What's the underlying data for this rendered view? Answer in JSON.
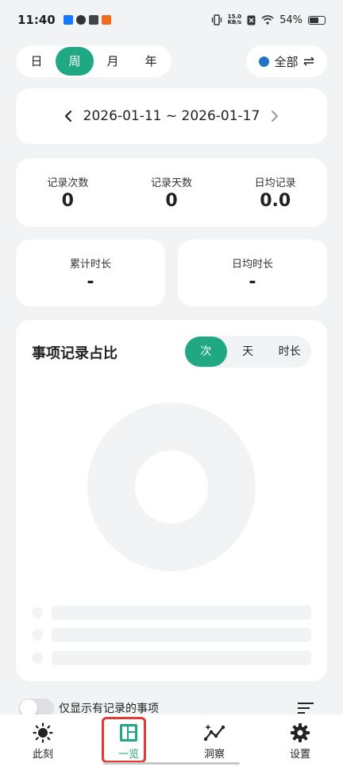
{
  "status": {
    "time": "11:40",
    "net_speed_top": "15.0",
    "net_speed_bottom": "KB/s",
    "battery": "54%"
  },
  "period": {
    "options": [
      "日",
      "周",
      "月",
      "年"
    ],
    "selected": "周"
  },
  "filter": {
    "label": "全部",
    "dot_color": "#1f74c4"
  },
  "date_range": {
    "text": "2026-01-11 ~ 2026-01-17"
  },
  "stats": {
    "record_count": {
      "label": "记录次数",
      "value": "0"
    },
    "record_days": {
      "label": "记录天数",
      "value": "0"
    },
    "daily_avg_records": {
      "label": "日均记录",
      "value": "0.0"
    },
    "total_duration": {
      "label": "累计时长",
      "value": "-"
    },
    "daily_avg_duration": {
      "label": "日均时长",
      "value": "-"
    }
  },
  "chart": {
    "title": "事项记录占比",
    "metric_options": [
      "次",
      "天",
      "时长"
    ],
    "selected_metric": "次"
  },
  "toggle": {
    "label": "仅显示有记录的事项",
    "checked": false
  },
  "nav": {
    "items": [
      {
        "label": "此刻",
        "icon": "sun-icon"
      },
      {
        "label": "一览",
        "icon": "dashboard-icon"
      },
      {
        "label": "洞察",
        "icon": "trend-icon"
      },
      {
        "label": "设置",
        "icon": "gear-icon"
      }
    ],
    "active": "一览"
  },
  "colors": {
    "accent": "#20a882",
    "highlight": "#e53935"
  }
}
